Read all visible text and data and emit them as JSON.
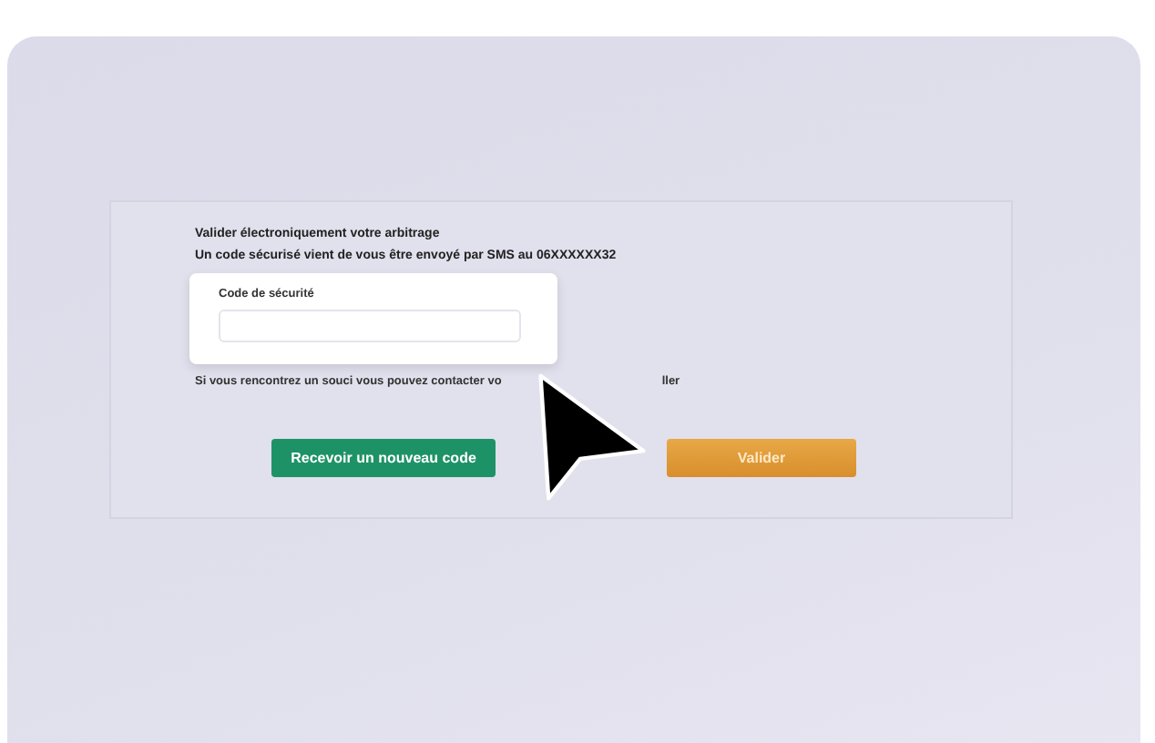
{
  "form": {
    "title": "Valider électroniquement votre arbitrage",
    "subtitle": "Un code sécurisé vient de vous être envoyé par SMS au 06XXXXXX32",
    "code_field": {
      "label": "Code de sécurité"
    },
    "help_text_start": "Si vous rencontrez un souci vous pouvez contacter vo",
    "help_text_end": "ller",
    "buttons": [
      {
        "kind": "secondary",
        "label": "Recevoir un nouveau code"
      },
      {
        "kind": "primary",
        "label": "Valider"
      }
    ]
  }
}
